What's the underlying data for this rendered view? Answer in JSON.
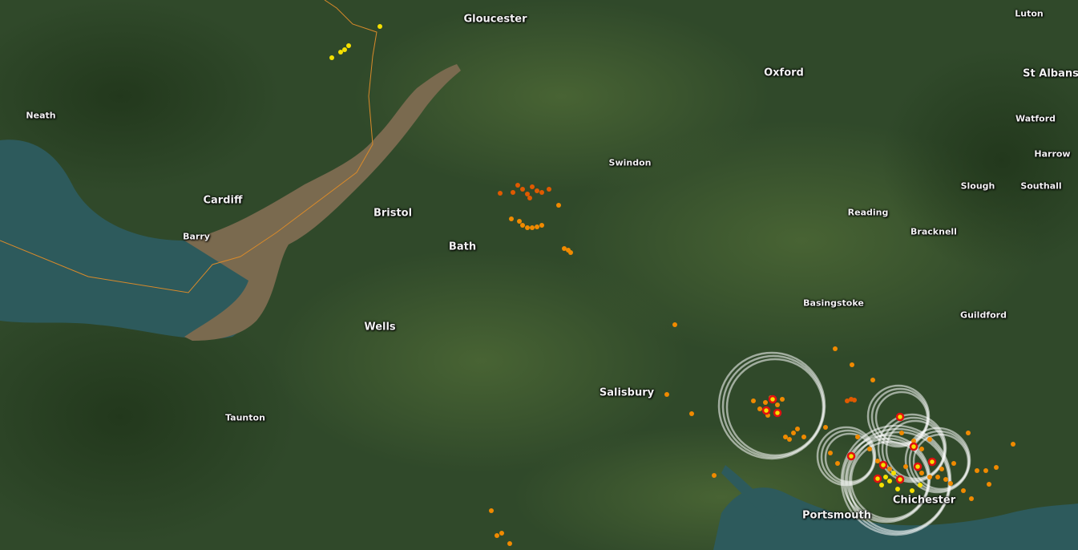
{
  "map": {
    "type": "satellite-basemap",
    "colors": {
      "land": "#2f4a26",
      "land_light": "#4a6234",
      "sea": "#2d5a5c",
      "estuary": "#7a6a4f",
      "border": "#d98a2a"
    },
    "places": [
      {
        "id": "gloucester",
        "name": "Gloucester",
        "size": "major"
      },
      {
        "id": "luton",
        "name": "Luton",
        "size": "minor"
      },
      {
        "id": "oxford",
        "name": "Oxford",
        "size": "major"
      },
      {
        "id": "st-albans",
        "name": "St Albans",
        "size": "major"
      },
      {
        "id": "neath",
        "name": "Neath",
        "size": "minor"
      },
      {
        "id": "watford",
        "name": "Watford",
        "size": "minor"
      },
      {
        "id": "swindon",
        "name": "Swindon",
        "size": "minor"
      },
      {
        "id": "harrow",
        "name": "Harrow",
        "size": "minor"
      },
      {
        "id": "cardiff",
        "name": "Cardiff",
        "size": "major"
      },
      {
        "id": "slough",
        "name": "Slough",
        "size": "minor"
      },
      {
        "id": "southall",
        "name": "Southall",
        "size": "minor"
      },
      {
        "id": "bristol",
        "name": "Bristol",
        "size": "major"
      },
      {
        "id": "reading",
        "name": "Reading",
        "size": "minor"
      },
      {
        "id": "bracknell",
        "name": "Bracknell",
        "size": "minor"
      },
      {
        "id": "barry",
        "name": "Barry",
        "size": "minor"
      },
      {
        "id": "bath",
        "name": "Bath",
        "size": "major"
      },
      {
        "id": "basingstoke",
        "name": "Basingstoke",
        "size": "minor"
      },
      {
        "id": "guildford",
        "name": "Guildford",
        "size": "minor"
      },
      {
        "id": "wells",
        "name": "Wells",
        "size": "major"
      },
      {
        "id": "salisbury",
        "name": "Salisbury",
        "size": "major"
      },
      {
        "id": "taunton",
        "name": "Taunton",
        "size": "minor"
      },
      {
        "id": "chichester",
        "name": "Chichester",
        "size": "major"
      },
      {
        "id": "portsmouth",
        "name": "Portsmouth",
        "size": "major"
      }
    ],
    "marker_colors": {
      "yellow": "#f5e000",
      "orange": "#f08a00",
      "dark-orange": "#e05a00",
      "red": "#e01010",
      "ring": "#ffffff"
    }
  }
}
